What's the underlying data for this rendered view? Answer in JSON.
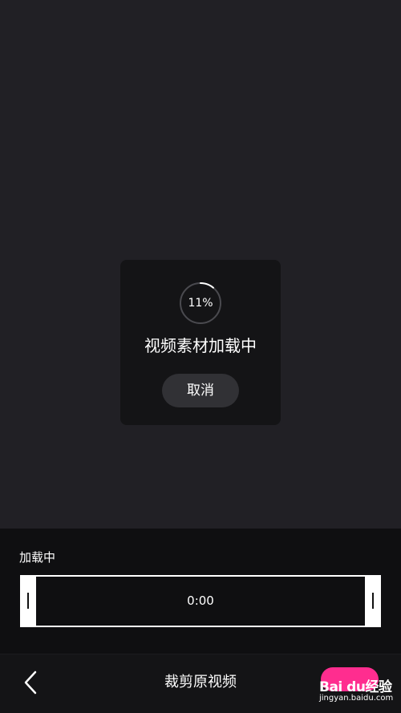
{
  "dialog": {
    "progress_label": "11%",
    "progress_value": 0.11,
    "title": "视频素材加载中",
    "cancel_label": "取消"
  },
  "trim_panel": {
    "label": "加载中",
    "time": "0:00"
  },
  "bottom_bar": {
    "back_icon": "chevron-left-icon",
    "title": "裁剪原视频"
  },
  "watermark": {
    "logo_text": "Bai du经验",
    "url": "jingyan.baidu.com"
  },
  "colors": {
    "background": "#212025",
    "dialog": "#141416",
    "button": "#313135",
    "accent_pink": "#ff2d8f",
    "text": "#ffffff"
  }
}
